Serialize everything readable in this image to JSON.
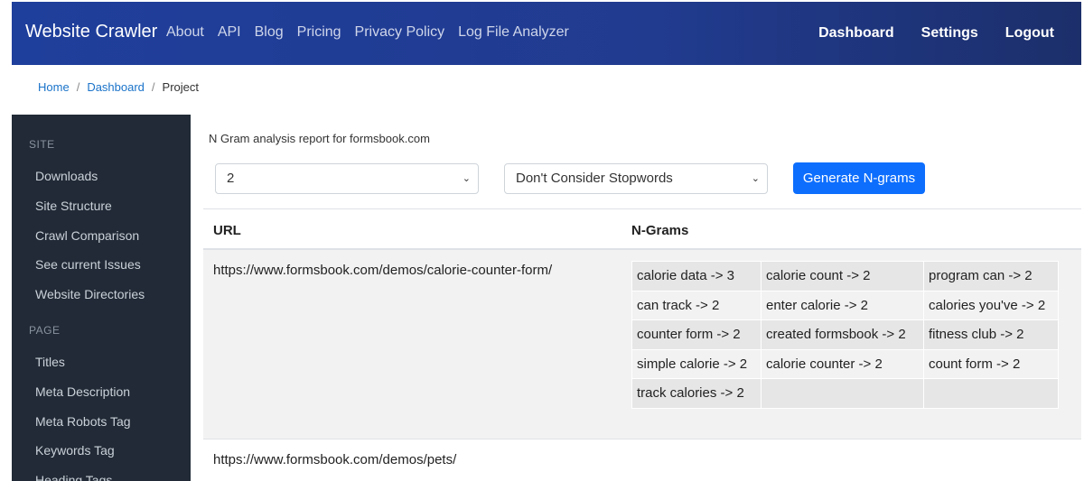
{
  "nav": {
    "brand": "Website Crawler",
    "links": [
      "About",
      "API",
      "Blog",
      "Pricing",
      "Privacy Policy",
      "Log File Analyzer"
    ],
    "right": [
      "Dashboard",
      "Settings",
      "Logout"
    ]
  },
  "breadcrumb": [
    "Home",
    "Dashboard",
    "Project"
  ],
  "sidebar": {
    "site_heading": "SITE",
    "site_items": [
      "Downloads",
      "Site Structure",
      "Crawl Comparison",
      "See current Issues",
      "Website Directories"
    ],
    "page_heading": "PAGE",
    "page_items": [
      "Titles",
      "Meta Description",
      "Meta Robots Tag",
      "Keywords Tag",
      "Heading Tags"
    ]
  },
  "main": {
    "report_title": "N Gram analysis report for formsbook.com",
    "n_select": "2",
    "stopwords_select": "Don't Consider Stopwords",
    "generate_label": "Generate N-grams",
    "col_url": "URL",
    "col_ngrams": "N-Grams",
    "rows": [
      {
        "url": "https://www.formsbook.com/demos/calorie-counter-form/",
        "ngrams": [
          [
            "calorie data -> 3",
            "calorie count -> 2",
            "program can -> 2"
          ],
          [
            "can track -> 2",
            "enter calorie -> 2",
            "calories you've -> 2"
          ],
          [
            "counter form -> 2",
            "created formsbook -> 2",
            "fitness club -> 2"
          ],
          [
            "simple calorie -> 2",
            "calorie counter -> 2",
            "count form -> 2"
          ],
          [
            "track calories -> 2",
            "",
            ""
          ]
        ]
      },
      {
        "url": "https://www.formsbook.com/demos/pets/"
      }
    ]
  }
}
